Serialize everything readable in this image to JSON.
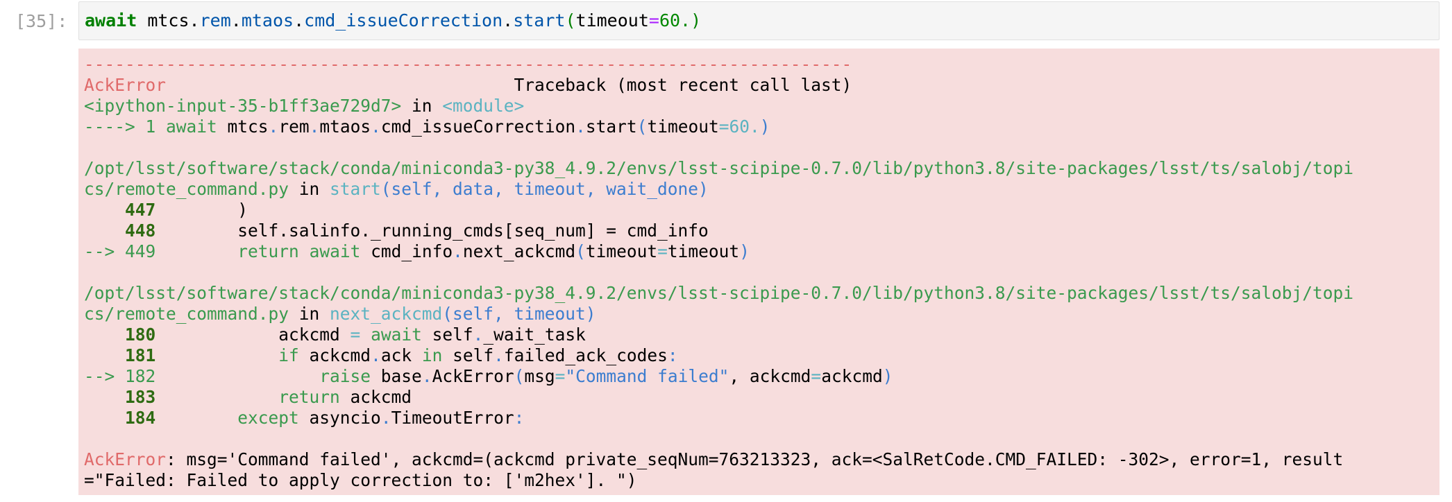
{
  "cell": {
    "prompt": "[35]:",
    "code": {
      "await_kw": "await",
      "obj": "mtcs",
      "dot1": ".",
      "rem": "rem",
      "dot2": ".",
      "mtaos": "mtaos",
      "dot3": ".",
      "cmd": "cmd_issueCorrection",
      "dot4": ".",
      "start": "start",
      "lparen": "(",
      "arg": "timeout",
      "eq": "=",
      "val": "60.",
      "rparen": ")"
    }
  },
  "traceback": {
    "separator": "---------------------------------------------------------------------------",
    "error_name": "AckError",
    "header_gap": "                                  ",
    "header_text": "Traceback (most recent call last)",
    "frame0": {
      "location": "<ipython-input-35-b1ff3ae729d7>",
      "in_word": " in ",
      "module": "<module>",
      "arrow": "----> 1 ",
      "code_await": "await",
      "code_obj": " mtcs",
      "d1": ".",
      "code_rem": "rem",
      "d2": ".",
      "code_mtaos": "mtaos",
      "d3": ".",
      "code_cmd": "cmd_issueCorrection",
      "d4": ".",
      "code_start": "start",
      "lparen": "(",
      "arg": "timeout",
      "eq": "=",
      "val": "60.",
      "rparen": ")"
    },
    "frame1": {
      "path_line1": "/opt/lsst/software/stack/conda/miniconda3-py38_4.9.2/envs/lsst-scipipe-0.7.0/lib/python3.8/site-packages/lsst/ts/salobj/topi",
      "path_line2": "cs/remote_command.py",
      "in_word": " in ",
      "func": "start",
      "sig": "(self, data, timeout, wait_done)",
      "lines": [
        {
          "gutter": "    447",
          "code": "        )"
        },
        {
          "gutter": "    448",
          "code": "        self.salinfo._running_cmds[seq_num] = cmd_info"
        }
      ],
      "arrow_gutter": "--> 449",
      "arrow_indent": "        ",
      "arrow_return": "return",
      "arrow_space": " ",
      "arrow_await": "await",
      "arrow_rest": " cmd_info",
      "arrow_dot": ".",
      "arrow_call": "next_ackcmd",
      "arrow_lparen": "(",
      "arrow_arg": "timeout",
      "arrow_eq": "=",
      "arrow_val": "timeout",
      "arrow_rparen": ")"
    },
    "frame2": {
      "path_line1": "/opt/lsst/software/stack/conda/miniconda3-py38_4.9.2/envs/lsst-scipipe-0.7.0/lib/python3.8/site-packages/lsst/ts/salobj/topi",
      "path_line2": "cs/remote_command.py",
      "in_word": " in ",
      "func": "next_ackcmd",
      "sig": "(self, timeout)",
      "l180_gutter": "    180",
      "l180_indent": "            ackcmd ",
      "l180_eq": "=",
      "l180_sp": " ",
      "l180_await": "await",
      "l180_rest": " self",
      "l180_dot": ".",
      "l180_attr": "_wait_task",
      "l181_gutter": "    181",
      "l181_indent": "            ",
      "l181_if": "if",
      "l181_mid": " ackcmd",
      "l181_dot": ".",
      "l181_ack": "ack ",
      "l181_in": "in",
      "l181_self": " self",
      "l181_dot2": ".",
      "l181_attr": "failed_ack_codes",
      "l181_colon": ":",
      "l182_gutter": "--> 182",
      "l182_indent": "                ",
      "l182_raise": "raise",
      "l182_base": " base",
      "l182_dot": ".",
      "l182_cls": "AckError",
      "l182_lparen": "(",
      "l182_msg": "msg",
      "l182_eq": "=",
      "l182_str": "\"Command failed\"",
      "l182_comma": ", ackcmd",
      "l182_eq2": "=",
      "l182_val": "ackcmd",
      "l182_rparen": ")",
      "l183_gutter": "    183",
      "l183_indent": "            ",
      "l183_return": "return",
      "l183_rest": " ackcmd",
      "l184_gutter": "    184",
      "l184_indent": "        ",
      "l184_except": "except",
      "l184_rest": " asyncio",
      "l184_dot": ".",
      "l184_attr": "TimeoutError",
      "l184_colon": ":"
    },
    "final_error": {
      "name": "AckError",
      "line1": ": msg='Command failed', ackcmd=(ackcmd private_seqNum=763213323, ack=<SalRetCode.CMD_FAILED: -302>, error=1, result",
      "line2": "=\"Failed: Failed to apply correction to: ['m2hex']. \")"
    }
  },
  "colors": {
    "error_background": "#f7dddd",
    "input_background": "#f5f5f5",
    "red": "#e06a6a",
    "green": "#3a9a4e",
    "cyan": "#5bb3c1",
    "blue": "#3c7dcf",
    "line_number": "#2e6b12"
  }
}
